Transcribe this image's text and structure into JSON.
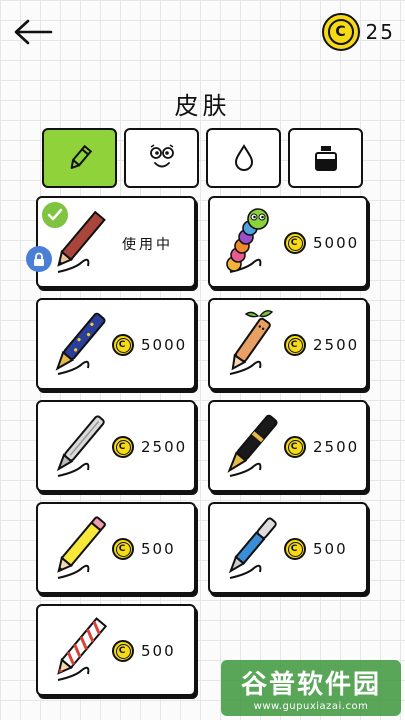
{
  "header": {
    "back_icon": "back-arrow-icon",
    "coins": "25"
  },
  "title": "皮肤",
  "tabs": [
    {
      "icon": "pencil-icon",
      "active": true
    },
    {
      "icon": "face-icon",
      "active": false
    },
    {
      "icon": "drop-icon",
      "active": false
    },
    {
      "icon": "ink-bottle-icon",
      "active": false
    }
  ],
  "skins": [
    {
      "name": "brown-pencil",
      "status": "使用中",
      "selected": true,
      "locked": true
    },
    {
      "name": "caterpillar-pen",
      "price": "5000"
    },
    {
      "name": "starry-fountain-pen",
      "price": "5000"
    },
    {
      "name": "sprout-pen",
      "price": "2500"
    },
    {
      "name": "silver-ballpoint",
      "price": "2500"
    },
    {
      "name": "black-fountain-pen",
      "price": "2500"
    },
    {
      "name": "yellow-pencil",
      "price": "500"
    },
    {
      "name": "blue-ballpoint",
      "price": "500"
    },
    {
      "name": "candy-stripe-pencil",
      "price": "500"
    }
  ],
  "colors": {
    "accent_green": "#8fd23a",
    "coin_yellow": "#f5da14",
    "lock_blue": "#4a7fd8"
  },
  "watermark": {
    "main": "谷普软件园",
    "url": "www.gupuxiazai.com"
  }
}
